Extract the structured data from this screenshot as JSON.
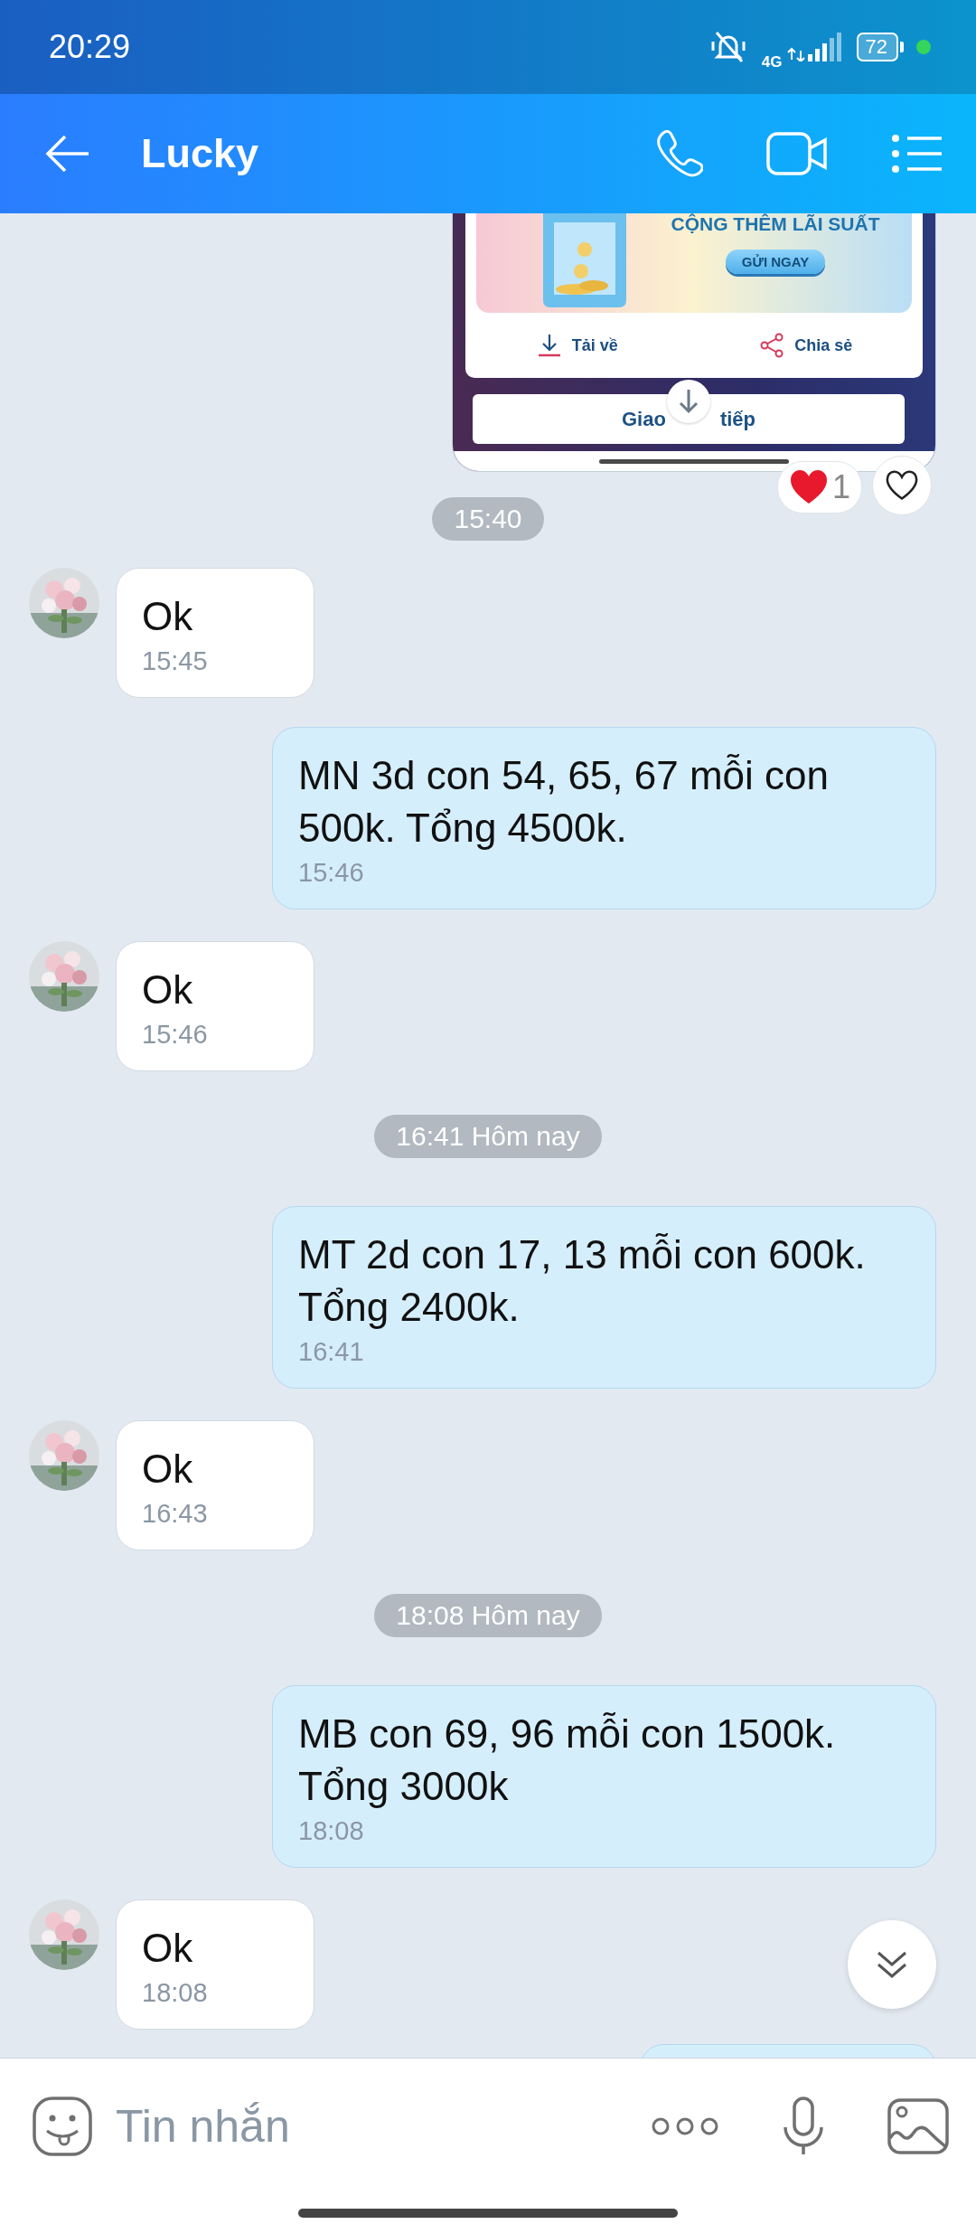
{
  "status_bar": {
    "time": "20:29",
    "network": "4G",
    "battery": "72"
  },
  "header": {
    "title": "Lucky"
  },
  "messages": [
    {
      "kind": "image_card",
      "banner_title": "CỘNG THÊM LÃI SUẤT",
      "banner_button": "GỬI NGAY",
      "actions": [
        "Tải về",
        "Chia sẻ"
      ],
      "button_parts": [
        "Giao",
        "tiếp"
      ],
      "reaction_count": "1"
    },
    {
      "kind": "time_pill",
      "text": "15:40"
    },
    {
      "kind": "received",
      "text": "Ok",
      "time": "15:45"
    },
    {
      "kind": "sent",
      "text": "MN 3d con 54, 65, 67 mỗi con 500k. Tổng 4500k.",
      "time": "15:46"
    },
    {
      "kind": "received",
      "text": "Ok",
      "time": "15:46"
    },
    {
      "kind": "time_pill",
      "text": "16:41 Hôm nay"
    },
    {
      "kind": "sent",
      "text": "MT 2d con 17, 13 mỗi con 600k. Tổng 2400k.",
      "time": "16:41"
    },
    {
      "kind": "received",
      "text": "Ok",
      "time": "16:43"
    },
    {
      "kind": "time_pill",
      "text": "18:08 Hôm nay"
    },
    {
      "kind": "sent",
      "text": "MB con 69, 96 mỗi con 1500k. Tổng 3000k",
      "time": "18:08"
    },
    {
      "kind": "received",
      "text": "Ok",
      "time": "18:08"
    },
    {
      "kind": "partial"
    }
  ],
  "composer": {
    "placeholder": "Tin nhắn"
  }
}
